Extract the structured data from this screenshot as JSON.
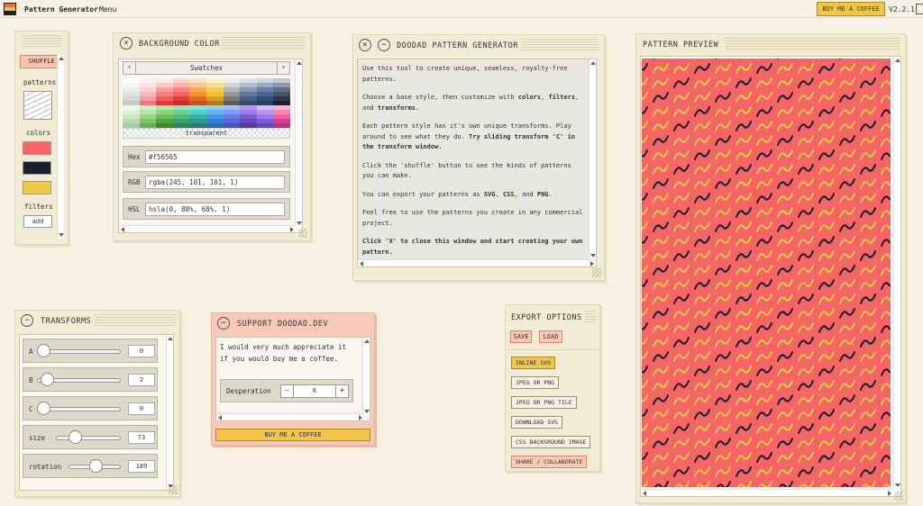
{
  "app": {
    "title": "Pattern Generator",
    "menu": "Menu",
    "coffee": "BUY ME A COFFEE",
    "version": "V2.2.1"
  },
  "left_panel": {
    "shuffle": "SHUFFLE",
    "patterns_label": "patterns",
    "colors_label": "colors",
    "colors": [
      "#f56565",
      "#1a202c",
      "#ecc94b"
    ],
    "filters_label": "filters",
    "add": "add"
  },
  "bg_color": {
    "title": "BACKGROUND COLOR",
    "swatches_label": "Swatches",
    "transparent": "transparent",
    "hex_label": "Hex",
    "hex_value": "#f56565",
    "rgb_label": "RGB",
    "rgb_value": "rgba(245, 101, 101, 1)",
    "hsl_label": "HSL",
    "hsl_value": "hsla(0, 88%, 68%, 1)",
    "palette": [
      [
        "#ffffff",
        "#fef1f1",
        "#fde7e7",
        "#fcd3cf",
        "#fae1c3",
        "#f5f5d1",
        "#f0f0f0",
        "#dde0e8",
        "#cfd5e0",
        "#c2c7d2"
      ],
      [
        "#f7f7f7",
        "#fde2e2",
        "#fbc7c7",
        "#fab2a8",
        "#f8c691",
        "#f2e08f",
        "#d4d4d4",
        "#b2bdcf",
        "#9aa9c2",
        "#8d98ad"
      ],
      [
        "#ededed",
        "#fbd0d0",
        "#fc9f9f",
        "#f98a7a",
        "#f7a95a",
        "#f1cf55",
        "#b5b5b5",
        "#8998b5",
        "#6780a4",
        "#5f6c86"
      ],
      [
        "#e2e2e2",
        "#fab9b9",
        "#f87f7f",
        "#f56565",
        "#f39133",
        "#eec12e",
        "#999999",
        "#6378a0",
        "#486293",
        "#445068"
      ],
      [
        "#d6d6d6",
        "#f5a0a0",
        "#f05b5b",
        "#e53e3e",
        "#dd6b20",
        "#d69e2e",
        "#7a7a7a",
        "#4a5f87",
        "#344c7b",
        "#2d3748"
      ],
      [
        "#c9c9c9",
        "#f07a7a",
        "#e03a3a",
        "#c53030",
        "#c05621",
        "#b7791f",
        "#5e5e5e",
        "#3a4b6c",
        "#2a3d63",
        "#1a202c"
      ],
      [
        "#edf7e9",
        "#d2f0c6",
        "#b5e6a6",
        "#9ae6b4",
        "#81e6d9",
        "#90cdf4",
        "#a3bffa",
        "#b794f4",
        "#d6bcfa",
        "#fbb6ce"
      ],
      [
        "#dff2d8",
        "#b9e6a8",
        "#8fd67d",
        "#68d391",
        "#4fd1c5",
        "#63b3ed",
        "#7f9cf5",
        "#9f7aea",
        "#b794f4",
        "#f687b3"
      ],
      [
        "#cde8c3",
        "#98d684",
        "#6cc257",
        "#48bb78",
        "#38b2ac",
        "#4299e1",
        "#667eea",
        "#805ad5",
        "#9f7aea",
        "#ed64a6"
      ],
      [
        "#b9dcae",
        "#7fc469",
        "#4fa83a",
        "#38a169",
        "#319795",
        "#3182ce",
        "#5a67d8",
        "#6b46c1",
        "#805ad5",
        "#d53f8c"
      ],
      [
        "#a4cf98",
        "#66b04e",
        "#3d8a2b",
        "#2f855a",
        "#2c7a7b",
        "#2b6cb0",
        "#4c51bf",
        "#553c9a",
        "#6b46c1",
        "#b83280"
      ]
    ]
  },
  "doodad": {
    "title": "DOODAD PATTERN GENERATOR",
    "p1": "Use this tool to create unique, seamless, royalty-free patterns.",
    "p2a": "Choose a base style, then customize with ",
    "p2b": "colors",
    "p2c": ", ",
    "p2d": "filters",
    "p2e": ", and ",
    "p2f": "transforms",
    "p2g": ".",
    "p3a": "Each pattern style has it's own unique transforms. Play around to see what they do. ",
    "p3b": "Try sliding transform 'C' in the transform window.",
    "p4": "Click the 'shuffle' button to see the kinds of patterns you can make.",
    "p5a": "You can export your patterns as ",
    "p5b": "SVG",
    "p5c": ", ",
    "p5d": "CSS",
    "p5e": ", and ",
    "p5f": "PNG",
    "p5g": ".",
    "p6": "Feel free to use the patterns you create in any commercial project.",
    "p7": "Click 'X' to close this window and start creating your own pattern."
  },
  "preview": {
    "title": "PATTERN PREVIEW",
    "background": "#f56565",
    "colors": [
      "#1a202c",
      "#ecc94b"
    ]
  },
  "transforms": {
    "title": "TRANSFORMS",
    "rows": [
      {
        "label": "A",
        "value": "0",
        "level": 0.0
      },
      {
        "label": "B",
        "value": "2",
        "level": 0.05
      },
      {
        "label": "C",
        "value": "0",
        "level": 0.0
      },
      {
        "label": "size",
        "value": "73",
        "level": 0.25
      },
      {
        "label": "rotation",
        "value": "189",
        "level": 0.53
      }
    ]
  },
  "support": {
    "title": "SUPPORT DOODAD.DEV",
    "text": "I would very much appreciate it if you would buy me a coffee.",
    "desperation_label": "Desperation",
    "minus": "—",
    "value": "6",
    "plus": "+",
    "button": "BUY ME A COFFEE"
  },
  "export": {
    "title": "EXPORT OPTIONS",
    "save": "SAVE",
    "load": "LOAD",
    "inline_svg": "INLINE SVG",
    "jpeg_png": "JPEG OR PNG",
    "jpeg_png_tile": "JPEG OR PNG TILE",
    "download_svg": "DOWNLOAD SVG",
    "css_bg": "CSS BACKGROUND IMAGE",
    "share": "SHARE / COLLABORATE"
  }
}
